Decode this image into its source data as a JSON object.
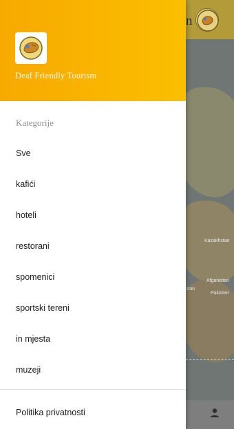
{
  "app": {
    "toolbar_title_fragment": "n"
  },
  "map": {
    "labels": [
      "Kazakhstan",
      "Afganistan",
      "Pakistan",
      "Iran"
    ]
  },
  "drawer": {
    "header": {
      "title": "Deaf Friendly Tourism"
    },
    "section_title": "Kategorije",
    "items": [
      {
        "label": "Sve"
      },
      {
        "label": "kafići"
      },
      {
        "label": "hoteli"
      },
      {
        "label": "restorani"
      },
      {
        "label": "spomenici"
      },
      {
        "label": "sportski tereni"
      },
      {
        "label": "in mjesta"
      },
      {
        "label": "muzeji"
      }
    ],
    "footer_item": "Politika privatnosti"
  },
  "icons": {
    "toolbar_logo": "hand-logo-icon",
    "header_logo": "hand-logo-icon",
    "bottom_nav": "person-icon"
  },
  "colors": {
    "drawer_header": "#f7a900",
    "map": "#6f7673"
  }
}
